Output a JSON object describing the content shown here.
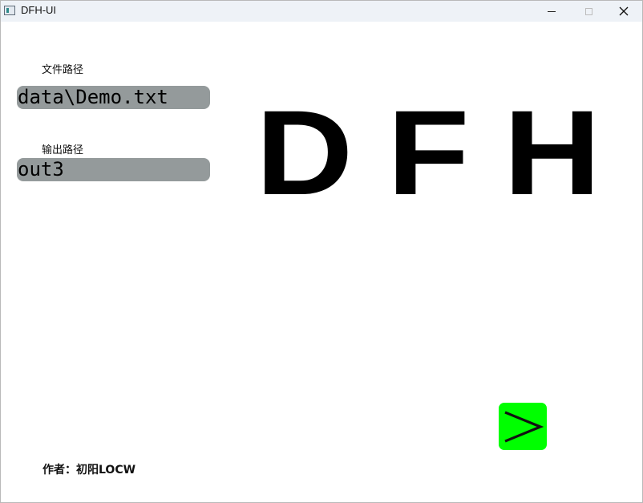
{
  "window": {
    "title": "DFH-UI",
    "icon": "app-window-icon",
    "controls": {
      "minimize": "minimize-icon",
      "maximize": "maximize-icon",
      "close": "close-icon",
      "close_glyph": "✕"
    }
  },
  "form": {
    "file_path_label": "文件路径",
    "file_path_value": "data\\Demo.txt",
    "output_path_label": "输出路径",
    "output_path_value": "out3"
  },
  "logo": {
    "text": "DFH"
  },
  "actions": {
    "next_icon": "chevron-right-icon",
    "next_color": "#00ff00"
  },
  "footer": {
    "author": "作者：初阳LOCW"
  },
  "colors": {
    "field_background": "#949a9b",
    "titlebar": "#eef2f7"
  }
}
